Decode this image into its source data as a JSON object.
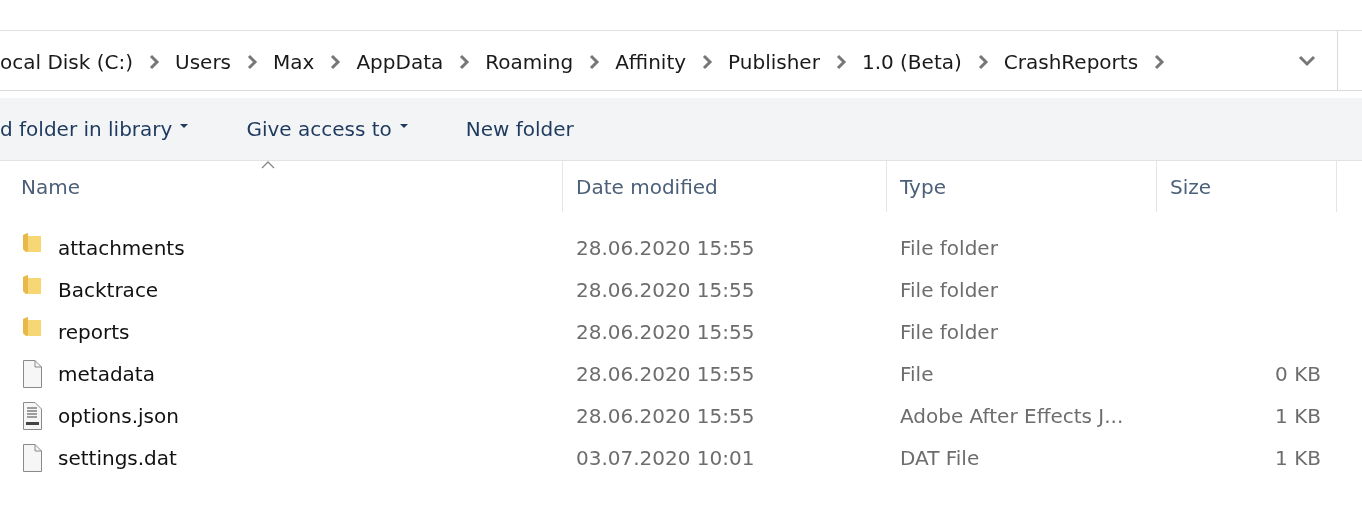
{
  "address_bar": {
    "segments": [
      "ocal Disk (C:)",
      "Users",
      "Max",
      "AppData",
      "Roaming",
      "Affinity",
      "Publisher",
      "1.0 (Beta)",
      "CrashReports"
    ]
  },
  "ribbon": {
    "commands": [
      {
        "label": "d folder in library",
        "dropdown": true
      },
      {
        "label": "Give access to",
        "dropdown": true
      },
      {
        "label": "New folder",
        "dropdown": false
      }
    ]
  },
  "table": {
    "columns": [
      {
        "label": "Name",
        "sorted": true
      },
      {
        "label": "Date modified",
        "sorted": false
      },
      {
        "label": "Type",
        "sorted": false
      },
      {
        "label": "Size",
        "sorted": false
      }
    ],
    "rows": [
      {
        "kind": "folder",
        "name": "attachments",
        "date": "28.06.2020 15:55",
        "type": "File folder"
      },
      {
        "kind": "folder",
        "name": "Backtrace",
        "date": "28.06.2020 15:55",
        "type": "File folder"
      },
      {
        "kind": "folder",
        "name": "reports",
        "date": "28.06.2020 15:55",
        "type": "File folder"
      },
      {
        "kind": "file",
        "name": "metadata",
        "date": "28.06.2020 15:55",
        "type": "File",
        "size": "0 KB"
      },
      {
        "kind": "json",
        "name": "options.json",
        "date": "28.06.2020 15:55",
        "type": "Adobe After Effects J...",
        "size": "1 KB"
      },
      {
        "kind": "file",
        "name": "settings.dat",
        "date": "03.07.2020 10:01",
        "type": "DAT File",
        "size": "1 KB"
      }
    ]
  }
}
